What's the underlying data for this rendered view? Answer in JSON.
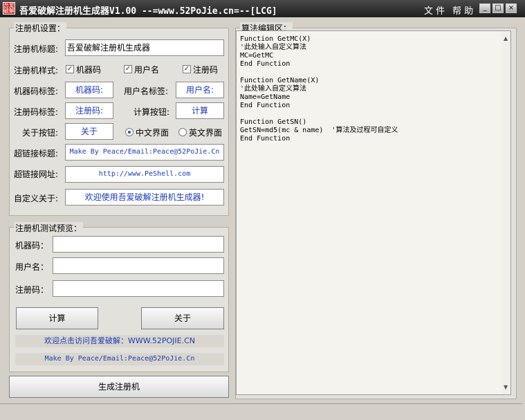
{
  "titlebar": {
    "title": "吾爱破解注册机生成器V1.00  --=www.52PoJie.cn=--[LCG]",
    "icon_text": "吾爱破解",
    "menu_file": "文 件",
    "menu_help": "帮 助",
    "min_glyph": "_",
    "max_glyph": "□",
    "close_glyph": "×"
  },
  "settings": {
    "group_title": "注册机设置：",
    "title_label": "注册机标题:",
    "title_value": "吾爱破解注册机生成器",
    "style_label": "注册机样式:",
    "chk_machine": "机器码",
    "chk_user": "用户名",
    "chk_regcode": "注册码",
    "check_glyph": "✓",
    "machine_label": "机器码标签:",
    "machine_value": "机器码:",
    "user_label": "用户名标签:",
    "user_value": "用户名:",
    "regcode_label": "注册码标签:",
    "regcode_value": "注册码:",
    "calc_label": "计算按钮:",
    "calc_value": "计算",
    "about_label": "关于按钮:",
    "about_value": "关于",
    "radio_cn": "中文界面",
    "radio_en": "英文界面",
    "link_title_label": "超链接标题:",
    "link_title_value": "Make By Peace/Email:Peace@52PoJie.Cn",
    "link_url_label": "超链接网址:",
    "link_url_value": "http://www.PeShell.com",
    "custom_about_label": "自定义关于:",
    "custom_about_value": "欢迎使用吾爱破解注册机生成器!"
  },
  "preview": {
    "group_title": "注册机测试预览：",
    "machine_label": "机器码：",
    "user_label": "用户名：",
    "regcode_label": "注册码：",
    "machine_value": "",
    "user_value": "",
    "regcode_value": "",
    "calc_button": "计算",
    "about_button": "关于",
    "link1": "欢迎点击访问吾爱破解：WWW.52POJIE.CN",
    "link2": "Make By Peace/Email:Peace@52PoJie.Cn"
  },
  "generate_button": "生成注册机",
  "editor": {
    "group_title": "算法编辑区：",
    "code": "Function GetMC(X)\n'此处输入自定义算法\nMC=GetMC\nEnd Function\n\nFunction GetName(X)\n'此处输入自定义算法\nName=GetName\nEnd Function\n\nFunction GetSN()\nGetSN=md5(mc & name)  '算法及过程可自定义\nEnd Function",
    "scroll_up": "▲",
    "scroll_down": "▼"
  }
}
